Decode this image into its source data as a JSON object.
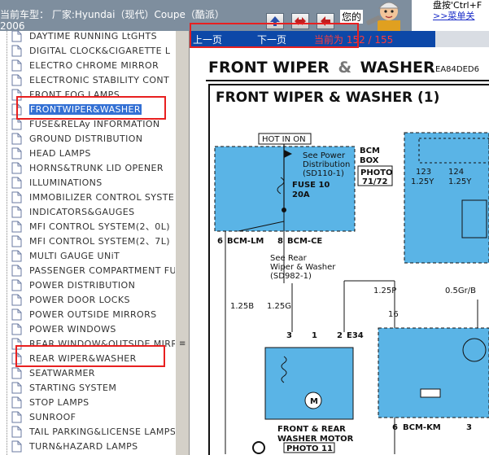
{
  "banner": {
    "car_info": "当前车型：  厂家:Hyundai（现代）Coupe（酷派）",
    "car_year": "2006",
    "your_label": "您的",
    "hint_text": "盘按'Ctrl+F",
    "hint_link": ">>菜单关"
  },
  "tree": {
    "items": [
      {
        "label": "DAYTIME RUNNING LtGHTS",
        "selected": false
      },
      {
        "label": "DIGITAL CLOCK&CIGARETTE L",
        "selected": false
      },
      {
        "label": "ELECTRO CHROME MIRROR",
        "selected": false
      },
      {
        "label": "ELECTRONIC STABILITY CONT",
        "selected": false
      },
      {
        "label": "FRONT FOG LAMPS",
        "selected": false
      },
      {
        "label": "FRONTWIPER&WASHER",
        "selected": true
      },
      {
        "label": "FUSE&RELAy INFORMATION",
        "selected": false
      },
      {
        "label": "GROUND DISTRIBUTION",
        "selected": false
      },
      {
        "label": "HEAD LAMPS",
        "selected": false
      },
      {
        "label": "HORNS&TRUNK LID OPENER",
        "selected": false
      },
      {
        "label": "ILLUMINATIONS",
        "selected": false
      },
      {
        "label": "IMMOBILIZER CONTROL SYSTE",
        "selected": false
      },
      {
        "label": "INDICATORS&GAUGES",
        "selected": false
      },
      {
        "label": "MFI CONTROL SYSTEM(2、0L)",
        "selected": false
      },
      {
        "label": "MFI CONTROL SYSTEM(2、7L)",
        "selected": false
      },
      {
        "label": "MULTI GAUGE UNiT",
        "selected": false
      },
      {
        "label": "PASSENGER COMPARTMENT FU",
        "selected": false
      },
      {
        "label": "POWER DISTRIBUTION",
        "selected": false
      },
      {
        "label": "POWER DOOR LOCKS",
        "selected": false
      },
      {
        "label": "POWER OUTSIDE MIRRORS",
        "selected": false
      },
      {
        "label": "POWER WINDOWS",
        "selected": false
      },
      {
        "label": "REAR WINDOW&OUTSIDE MIRR",
        "selected": false
      },
      {
        "label": "REAR WIPER&WASHER",
        "selected": false
      },
      {
        "label": "SEATWARMER",
        "selected": false
      },
      {
        "label": "STARTING SYSTEM",
        "selected": false
      },
      {
        "label": "STOP LAMPS",
        "selected": false
      },
      {
        "label": "SUNROOF",
        "selected": false
      },
      {
        "label": "TAIL PARKING&LICENSE LAMPS",
        "selected": false
      },
      {
        "label": "TURN&HAZARD LAMPS",
        "selected": false
      }
    ]
  },
  "splitter": {
    "grip": "≡"
  },
  "nav": {
    "prev": "上一页",
    "next": "下一页",
    "page_info": "当前为 152 / 155"
  },
  "doc": {
    "title": "FRONT WIPER",
    "title_amp": "&",
    "title_end": "WASHER",
    "code": "EA84DED6",
    "diagram_title": "FRONT WIPER & WASHER (1)"
  },
  "diagram": {
    "hot_in_on": "HOT IN ON",
    "see_power": "See Power",
    "distribution": "Distribution",
    "sd110": "(SD110-1)",
    "fuse": "FUSE 10",
    "amp": "20A",
    "bcm": "BCM",
    "box": "BOX",
    "photo1": "PHOTO",
    "photo1_num": "71/72",
    "pin6": "6",
    "bcm_lm": "BCM-LM",
    "pin8": "8",
    "bcm_ce": "BCM-CE",
    "see_rear": "See Rear",
    "wiper_washer": "Wiper & Washer",
    "sd982": "(SD982-1)",
    "w125b": "1.25B",
    "w125g": "1.25G",
    "w125p": "1.25P",
    "w05grb": "0.5Gr/B",
    "p16": "16",
    "p3a": "3",
    "p1": "1",
    "p2": "2",
    "e34": "E34",
    "motor_m": "M",
    "motor_name": "FRONT & REAR",
    "motor_name2": "WASHER MOTOR",
    "photo11": "PHOTO 11",
    "p123": "123",
    "p124": "124",
    "w125y1": "1.25Y",
    "w125y2": "1.25Y",
    "p6b": "6",
    "bcm_km": "BCM-KM",
    "p3b": "3"
  },
  "colors": {
    "banner_bg": "#7e8e9e",
    "nav_bg": "#0d48a8",
    "diagram_fill": "#5ab4e6",
    "highlight": "#e82020",
    "selection": "#3370d4"
  }
}
